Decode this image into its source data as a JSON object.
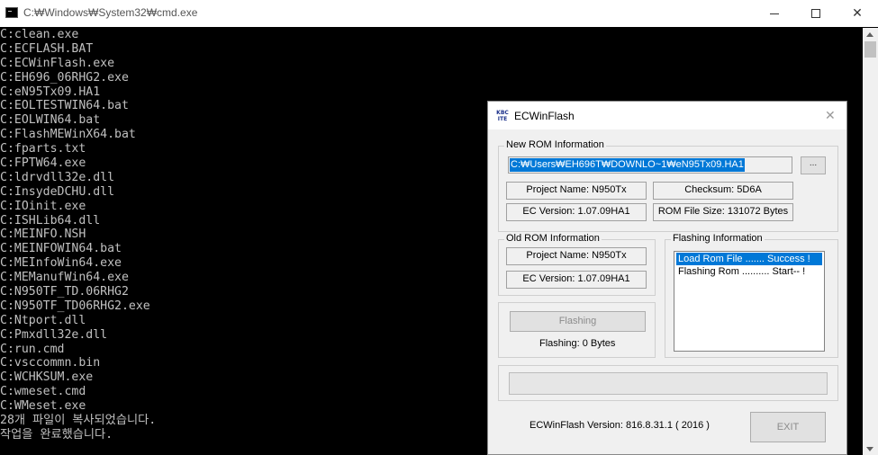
{
  "cmd_window": {
    "title": "C:₩Windows₩System32₩cmd.exe",
    "lines": [
      "C:clean.exe",
      "C:ECFLASH.BAT",
      "C:ECWinFlash.exe",
      "C:EH696_06RHG2.exe",
      "C:eN95Tx09.HA1",
      "C:EOLTESTWIN64.bat",
      "C:EOLWIN64.bat",
      "C:FlashMEWinX64.bat",
      "C:fparts.txt",
      "C:FPTW64.exe",
      "C:ldrvdll32e.dll",
      "C:InsydeDCHU.dll",
      "C:IOinit.exe",
      "C:ISHLib64.dll",
      "C:MEINFO.NSH",
      "C:MEINFOWIN64.bat",
      "C:MEInfoWin64.exe",
      "C:MEManufWin64.exe",
      "C:N950TF_TD.06RHG2",
      "C:N950TF_TD06RHG2.exe",
      "C:Ntport.dll",
      "C:Pmxdll32e.dll",
      "C:run.cmd",
      "C:vsccommn.bin",
      "C:WCHKSUM.exe",
      "C:wmeset.cmd",
      "C:WMeset.exe",
      "28개 파일이 복사되었습니다.",
      "작업을 완료했습니다."
    ]
  },
  "dialog": {
    "title": "ECWinFlash",
    "icon_text": "KBC ITE",
    "icon": "kbc-ite-icon",
    "new_rom": {
      "group_label": "New ROM Information",
      "path": "C:₩Users₩EH696T₩DOWNLO~1₩eN95Tx09.HA1",
      "browse_label": "...",
      "project_name": "Project Name: N950Tx",
      "checksum": "Checksum: 5D6A",
      "ec_version": "EC Version:  1.07.09HA1",
      "rom_file_size": "ROM File Size: 131072 Bytes"
    },
    "old_rom": {
      "group_label": "Old ROM Information",
      "project_name": "Project Name: N950Tx",
      "ec_version": "EC Version: 1.07.09HA1"
    },
    "flashing_info": {
      "group_label": "Flashing Information",
      "items": [
        "Load Rom File ....... Success !",
        "Flashing Rom .......... Start-- !"
      ]
    },
    "flash_button_label": "Flashing",
    "flash_status": "Flashing: 0 Bytes",
    "version_text": "ECWinFlash  Version: 816.8.31.1    ( 2016 )",
    "exit_label": "EXIT",
    "progress": 0,
    "selection_color": "#0078d7"
  }
}
